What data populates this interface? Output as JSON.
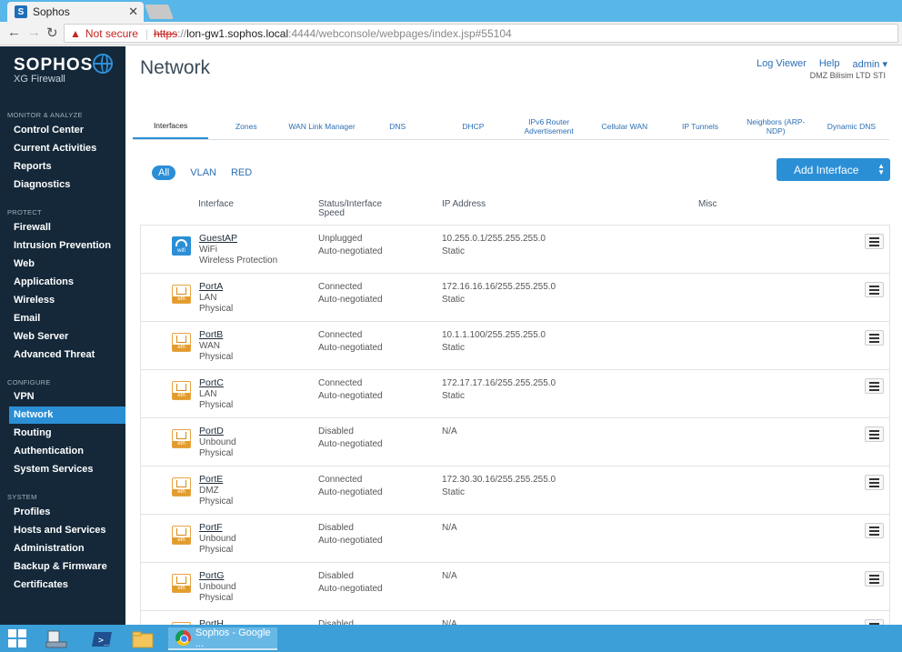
{
  "browser": {
    "tab_title": "Sophos",
    "tab_favicon": "S",
    "tab_close": "✕",
    "not_secure": "Not secure",
    "url_scheme": "https",
    "url_sep": "://",
    "url_host": "lon-gw1.sophos.local",
    "url_path": ":4444/webconsole/webpages/index.jsp#55104"
  },
  "sidebar": {
    "logo": "SOPHOS",
    "product": "XG Firewall",
    "sections": [
      {
        "label": "MONITOR & ANALYZE",
        "items": [
          "Control Center",
          "Current Activities",
          "Reports",
          "Diagnostics"
        ]
      },
      {
        "label": "PROTECT",
        "items": [
          "Firewall",
          "Intrusion Prevention",
          "Web",
          "Applications",
          "Wireless",
          "Email",
          "Web Server",
          "Advanced Threat"
        ]
      },
      {
        "label": "CONFIGURE",
        "items": [
          "VPN",
          "Network",
          "Routing",
          "Authentication",
          "System Services"
        ]
      },
      {
        "label": "SYSTEM",
        "items": [
          "Profiles",
          "Hosts and Services",
          "Administration",
          "Backup & Firmware",
          "Certificates"
        ]
      }
    ],
    "active_item": "Network"
  },
  "header": {
    "title": "Network",
    "links": [
      "Log Viewer",
      "Help",
      "admin ▾"
    ],
    "org": "DMZ Bilisim LTD STI"
  },
  "tabs": [
    "Interfaces",
    "Zones",
    "WAN Link Manager",
    "DNS",
    "DHCP",
    "IPv6 Router Advertisement",
    "Cellular WAN",
    "IP Tunnels",
    "Neighbors (ARP-NDP)",
    "Dynamic DNS"
  ],
  "active_tab": "Interfaces",
  "filters": [
    "All",
    "VLAN",
    "RED"
  ],
  "add_button": "Add Interface",
  "columns": {
    "interface": "Interface",
    "status": "Status/Interface Speed",
    "ip": "IP Address",
    "misc": "Misc"
  },
  "rows": [
    {
      "icon": "wifi-icon",
      "icon_label": "wifi",
      "name": "GuestAP",
      "zone": "WiFi",
      "type": "Wireless Protection",
      "status": "Unplugged",
      "speed": "Auto-negotiated",
      "ip": "10.255.0.1/255.255.255.0",
      "ip_mode": "Static"
    },
    {
      "icon": "ethernet-icon",
      "icon_label": "eth",
      "name": "PortA",
      "zone": "LAN",
      "type": "Physical",
      "status": "Connected",
      "speed": "Auto-negotiated",
      "ip": "172.16.16.16/255.255.255.0",
      "ip_mode": "Static"
    },
    {
      "icon": "ethernet-icon",
      "icon_label": "eth",
      "name": "PortB",
      "zone": "WAN",
      "type": "Physical",
      "status": "Connected",
      "speed": "Auto-negotiated",
      "ip": "10.1.1.100/255.255.255.0",
      "ip_mode": "Static"
    },
    {
      "icon": "ethernet-icon",
      "icon_label": "eth",
      "name": "PortC",
      "zone": "LAN",
      "type": "Physical",
      "status": "Connected",
      "speed": "Auto-negotiated",
      "ip": "172.17.17.16/255.255.255.0",
      "ip_mode": "Static"
    },
    {
      "icon": "ethernet-icon",
      "icon_label": "eth",
      "name": "PortD",
      "zone": "Unbound",
      "type": "Physical",
      "status": "Disabled",
      "speed": "Auto-negotiated",
      "ip": "N/A",
      "ip_mode": ""
    },
    {
      "icon": "ethernet-icon",
      "icon_label": "eth",
      "name": "PortE",
      "zone": "DMZ",
      "type": "Physical",
      "status": "Connected",
      "speed": "Auto-negotiated",
      "ip": "172.30.30.16/255.255.255.0",
      "ip_mode": "Static"
    },
    {
      "icon": "ethernet-icon",
      "icon_label": "eth",
      "name": "PortF",
      "zone": "Unbound",
      "type": "Physical",
      "status": "Disabled",
      "speed": "Auto-negotiated",
      "ip": "N/A",
      "ip_mode": ""
    },
    {
      "icon": "ethernet-icon",
      "icon_label": "eth",
      "name": "PortG",
      "zone": "Unbound",
      "type": "Physical",
      "status": "Disabled",
      "speed": "Auto-negotiated",
      "ip": "N/A",
      "ip_mode": ""
    },
    {
      "icon": "ethernet-icon",
      "icon_label": "eth",
      "name": "PortH",
      "zone": "",
      "type": "",
      "status": "Disabled",
      "speed": "",
      "ip": "N/A",
      "ip_mode": ""
    }
  ],
  "taskbar": {
    "active_window": "Sophos - Google ..."
  },
  "colors": {
    "accent": "#2b8fd6",
    "sidebar_bg": "#142839",
    "port_icon": "#e39c2c"
  }
}
